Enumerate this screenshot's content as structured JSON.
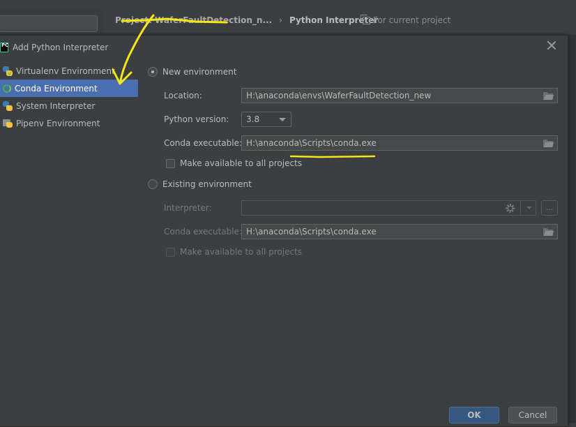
{
  "background": {
    "breadcrumb": {
      "project": "Project: WaferFaultDetection_n...",
      "separator": "›",
      "current": "Python Interpreter"
    },
    "scope_label": "For current project"
  },
  "dialog": {
    "title": "Add Python Interpreter",
    "sidebar": {
      "items": [
        {
          "label": "Virtualenv Environment",
          "icon": "virtualenv-icon",
          "selected": false
        },
        {
          "label": "Conda Environment",
          "icon": "conda-icon",
          "selected": true
        },
        {
          "label": "System Interpreter",
          "icon": "python-icon",
          "selected": false
        },
        {
          "label": "Pipenv Environment",
          "icon": "pipenv-icon",
          "selected": false
        }
      ]
    },
    "new_environment": {
      "option_label": "New environment",
      "selected": true,
      "location_label": "Location:",
      "location_value": "H:\\anaconda\\envs\\WaferFaultDetection_new",
      "python_version_label": "Python version:",
      "python_version_value": "3.8",
      "conda_executable_label": "Conda executable:",
      "conda_executable_value": "H:\\anaconda\\Scripts\\conda.exe",
      "make_available_label": "Make available to all projects",
      "make_available_checked": false
    },
    "existing_environment": {
      "option_label": "Existing environment",
      "selected": false,
      "interpreter_label": "Interpreter:",
      "interpreter_value": "",
      "more_label": "...",
      "conda_executable_label": "Conda executable:",
      "conda_executable_value": "H:\\anaconda\\Scripts\\conda.exe",
      "make_available_label": "Make available to all projects",
      "make_available_checked": false
    },
    "buttons": {
      "ok": "OK",
      "cancel": "Cancel"
    }
  },
  "annotation_color": "#f5e614"
}
